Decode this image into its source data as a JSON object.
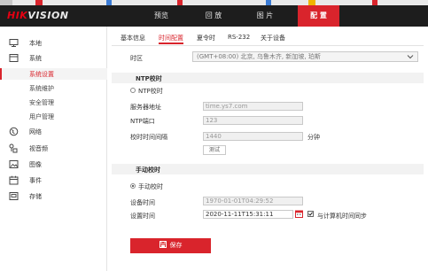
{
  "header": {
    "logo_prefix": "HIK",
    "logo_suffix": "VISION",
    "nav": [
      "预览",
      "回 放",
      "图 片",
      "配 置"
    ],
    "active_nav": "配 置",
    "accent_color": "#d9242c"
  },
  "sidebar": {
    "items": [
      {
        "label": "本地",
        "icon": "monitor-icon"
      },
      {
        "label": "系统",
        "icon": "system-icon"
      },
      {
        "label": "系统设置",
        "sub": true,
        "active": true
      },
      {
        "label": "系统维护",
        "sub": true
      },
      {
        "label": "安全管理",
        "sub": true
      },
      {
        "label": "用户管理",
        "sub": true
      },
      {
        "label": "网络",
        "icon": "globe-icon"
      },
      {
        "label": "视音频",
        "icon": "audio-video-icon"
      },
      {
        "label": "图像",
        "icon": "image-icon"
      },
      {
        "label": "事件",
        "icon": "calendar-icon"
      },
      {
        "label": "存储",
        "icon": "storage-icon"
      }
    ]
  },
  "tabs": [
    "基本信息",
    "时间配置",
    "夏令时",
    "RS-232",
    "关于设备"
  ],
  "active_tab": "时间配置",
  "form": {
    "timezone_label": "时区",
    "timezone_value": "(GMT+08:00) 北京, 乌鲁木齐, 新加坡, 珀斯",
    "ntp_section": "NTP校时",
    "ntp_radio_label": "NTP校时",
    "server_label": "服务器地址",
    "server_value": "time.ys7.com",
    "port_label": "NTP端口",
    "port_value": "123",
    "interval_label": "校时时间间隔",
    "interval_value": "1440",
    "interval_unit": "分钟",
    "test_button": "测试",
    "manual_section": "手动校时",
    "manual_radio_label": "手动校时",
    "device_time_label": "设备时间",
    "device_time_value": "1970-01-01T04:29:52",
    "set_time_label": "设置时间",
    "set_time_value": "2020-11-11T15:31:11",
    "sync_label": "与计算机时间同步",
    "sync_checked": true,
    "ntp_selected": false,
    "manual_selected": true
  },
  "save_button": "保存"
}
